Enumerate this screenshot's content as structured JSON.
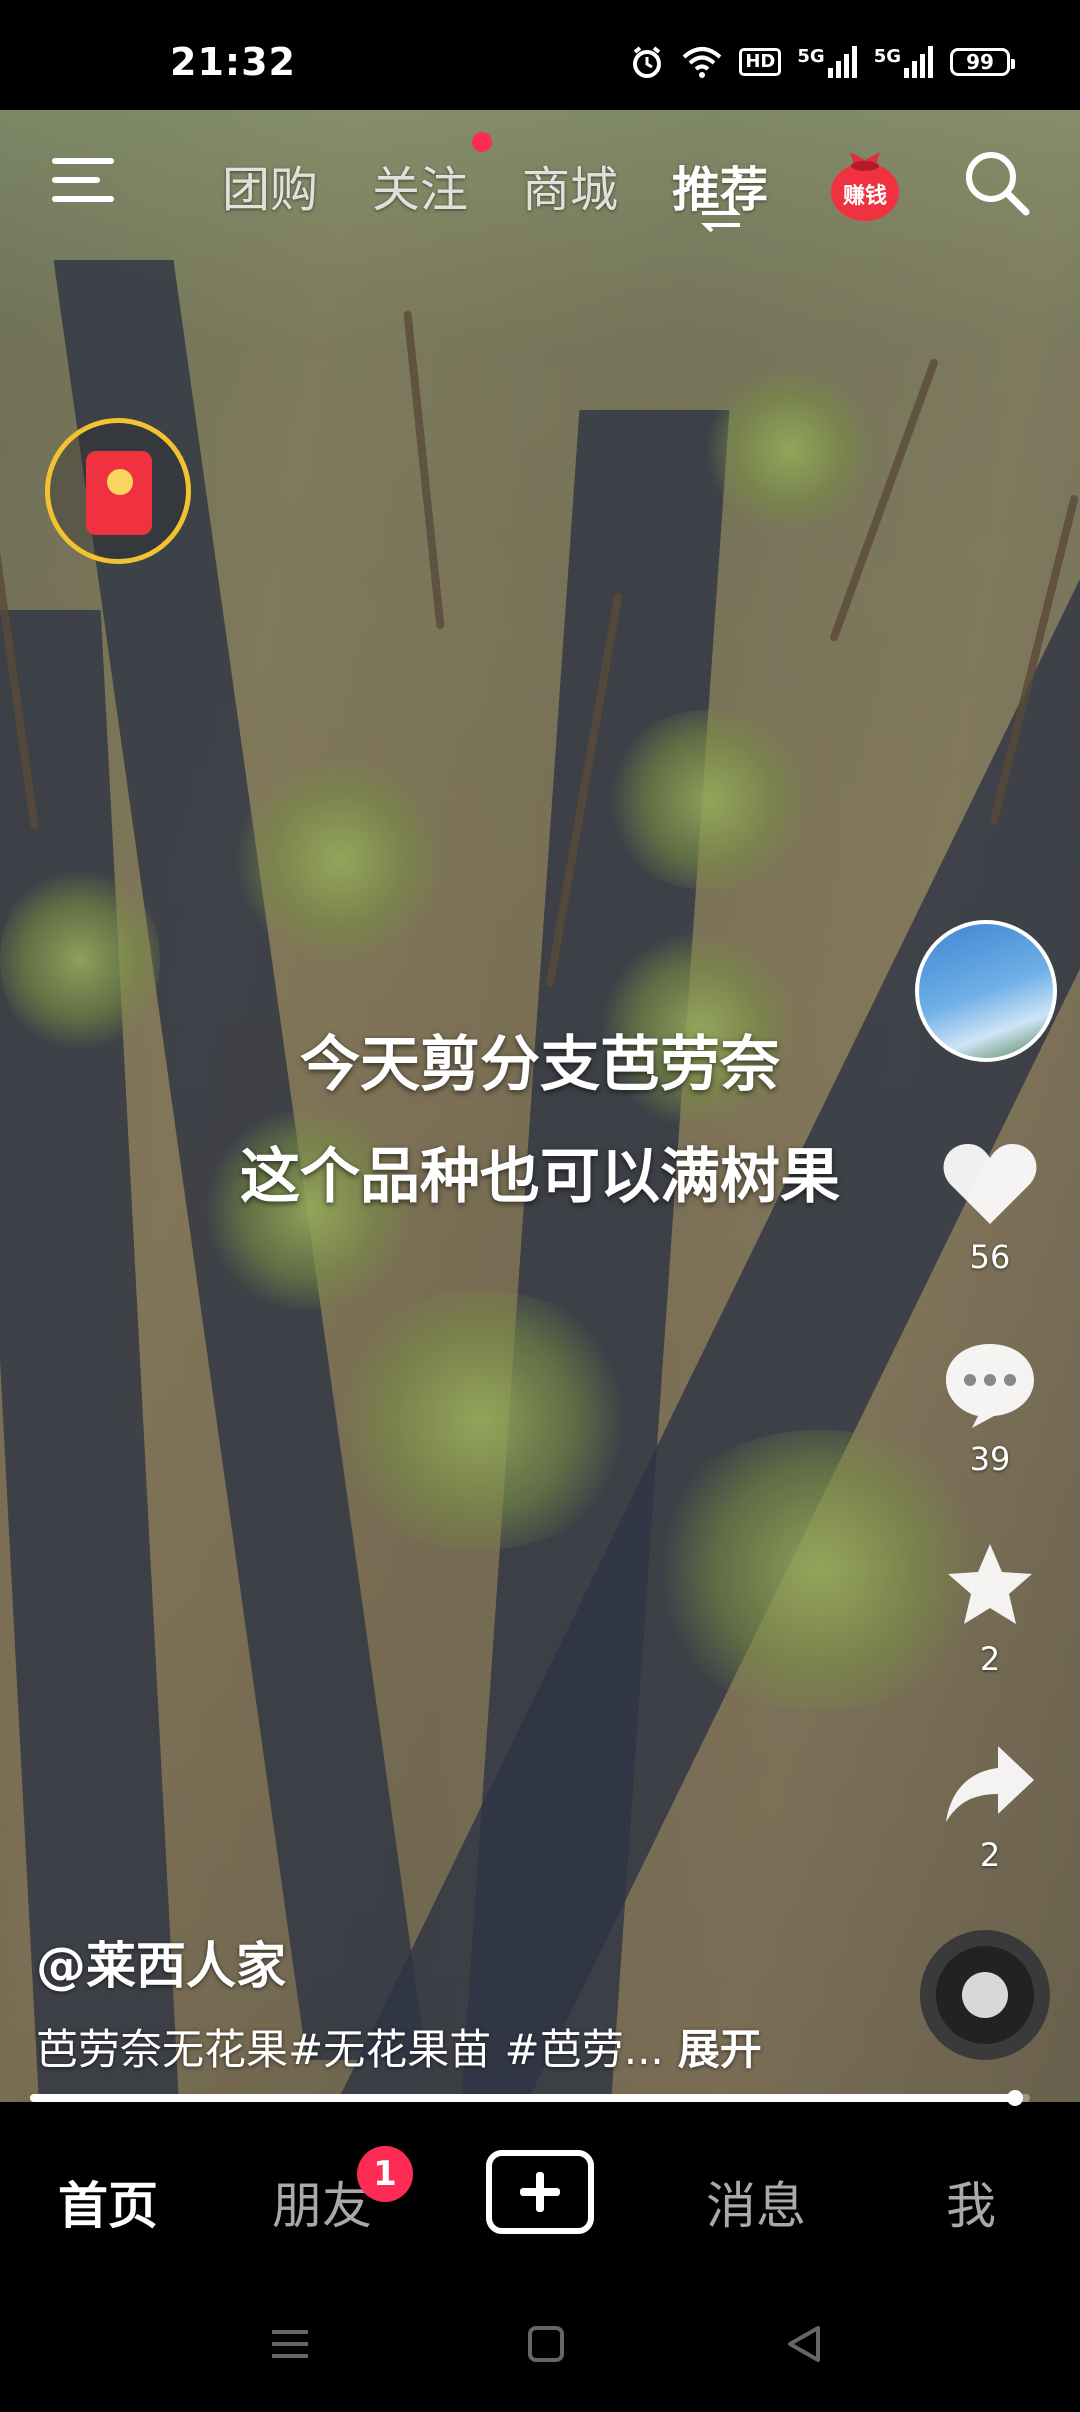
{
  "status_bar": {
    "time": "21:32",
    "icons": [
      "alarm-icon",
      "wifi-icon",
      "hd-icon",
      "5g-signal-icon",
      "5g-signal-icon"
    ],
    "hd_label": "HD",
    "network_label_1": "5G",
    "network_label_2": "5G",
    "battery": "99"
  },
  "top_nav": {
    "tabs": [
      {
        "label": "团购",
        "active": false
      },
      {
        "label": "关注",
        "active": false,
        "has_dot": true
      },
      {
        "label": "商城",
        "active": false
      },
      {
        "label": "推荐",
        "active": true
      }
    ],
    "earn_label": "赚钱"
  },
  "caption": {
    "line1": "今天剪分支芭劳奈",
    "line2": "这个品种也可以满树果"
  },
  "right_rail": {
    "like_count": "56",
    "comment_count": "39",
    "favorite_count": "2",
    "share_count": "2"
  },
  "post": {
    "author": "@莱西人家",
    "description": "芭劳奈无花果#无花果苗 #芭劳...",
    "expand_label": "展开",
    "progress": 0.985
  },
  "tab_bar": {
    "tabs": [
      {
        "label": "首页",
        "active": true
      },
      {
        "label": "朋友",
        "badge": "1"
      },
      {
        "label": "消息"
      },
      {
        "label": "我"
      }
    ]
  },
  "colors": {
    "accent": "#fe2c55",
    "red_packet": "#f0313f",
    "gold_ring": "#f2c230"
  }
}
